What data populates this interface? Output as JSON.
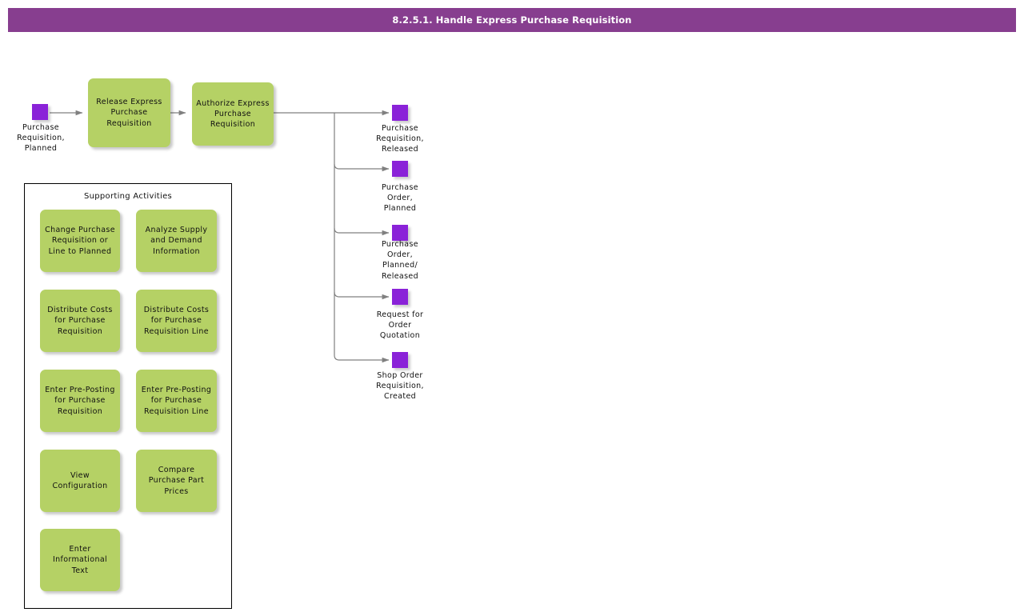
{
  "title_bar": {
    "text": "8.2.5.1. Handle Express Purchase Requisition",
    "background_color": "#873e8f",
    "text_color": "#ffffff"
  },
  "colors": {
    "activity_green": "#b5d165",
    "state_purple": "#8a22d8",
    "connector_gray": "#808080",
    "panel_border": "#000000"
  },
  "flow": {
    "input_state": {
      "name": "purchase-requisition-planned",
      "label": "Purchase\nRequisition,\nPlanned"
    },
    "activities": [
      {
        "name": "release-express-purchase-requisition",
        "label": "Release Express Purchase Requisition"
      },
      {
        "name": "authorize-express-purchase-requisition",
        "label": "Authorize Express Purchase Requisition"
      }
    ],
    "output_states": [
      {
        "name": "purchase-requisition-released",
        "label": "Purchase\nRequisition,\nReleased"
      },
      {
        "name": "purchase-order-planned",
        "label": "Purchase\nOrder,\nPlanned"
      },
      {
        "name": "purchase-order-planned-released",
        "label": "Purchase\nOrder,\nPlanned/\nReleased"
      },
      {
        "name": "request-for-order-quotation",
        "label": "Request for\nOrder\nQuotation"
      },
      {
        "name": "shop-order-requisition-created",
        "label": "Shop Order\nRequisition,\nCreated"
      }
    ]
  },
  "supporting_activities": {
    "title": "Supporting Activities",
    "items": [
      {
        "name": "change-purchase-requisition-or-line-to-planned",
        "label": "Change Purchase Requisition or Line to Planned"
      },
      {
        "name": "analyze-supply-and-demand-information",
        "label": "Analyze Supply and Demand Information"
      },
      {
        "name": "distribute-costs-for-purchase-requisition",
        "label": "Distribute Costs for Purchase Requisition"
      },
      {
        "name": "distribute-costs-for-purchase-requisition-line",
        "label": "Distribute Costs for Purchase Requisition Line"
      },
      {
        "name": "enter-pre-posting-for-purchase-requisition",
        "label": "Enter Pre-Posting for Purchase Requisition"
      },
      {
        "name": "enter-pre-posting-for-purchase-requisition-line",
        "label": "Enter Pre-Posting for Purchase Requisition Line"
      },
      {
        "name": "view-configuration",
        "label": "View Configuration"
      },
      {
        "name": "compare-purchase-part-prices",
        "label": "Compare Purchase Part Prices"
      },
      {
        "name": "enter-informational-text",
        "label": "Enter Informational Text"
      }
    ]
  }
}
